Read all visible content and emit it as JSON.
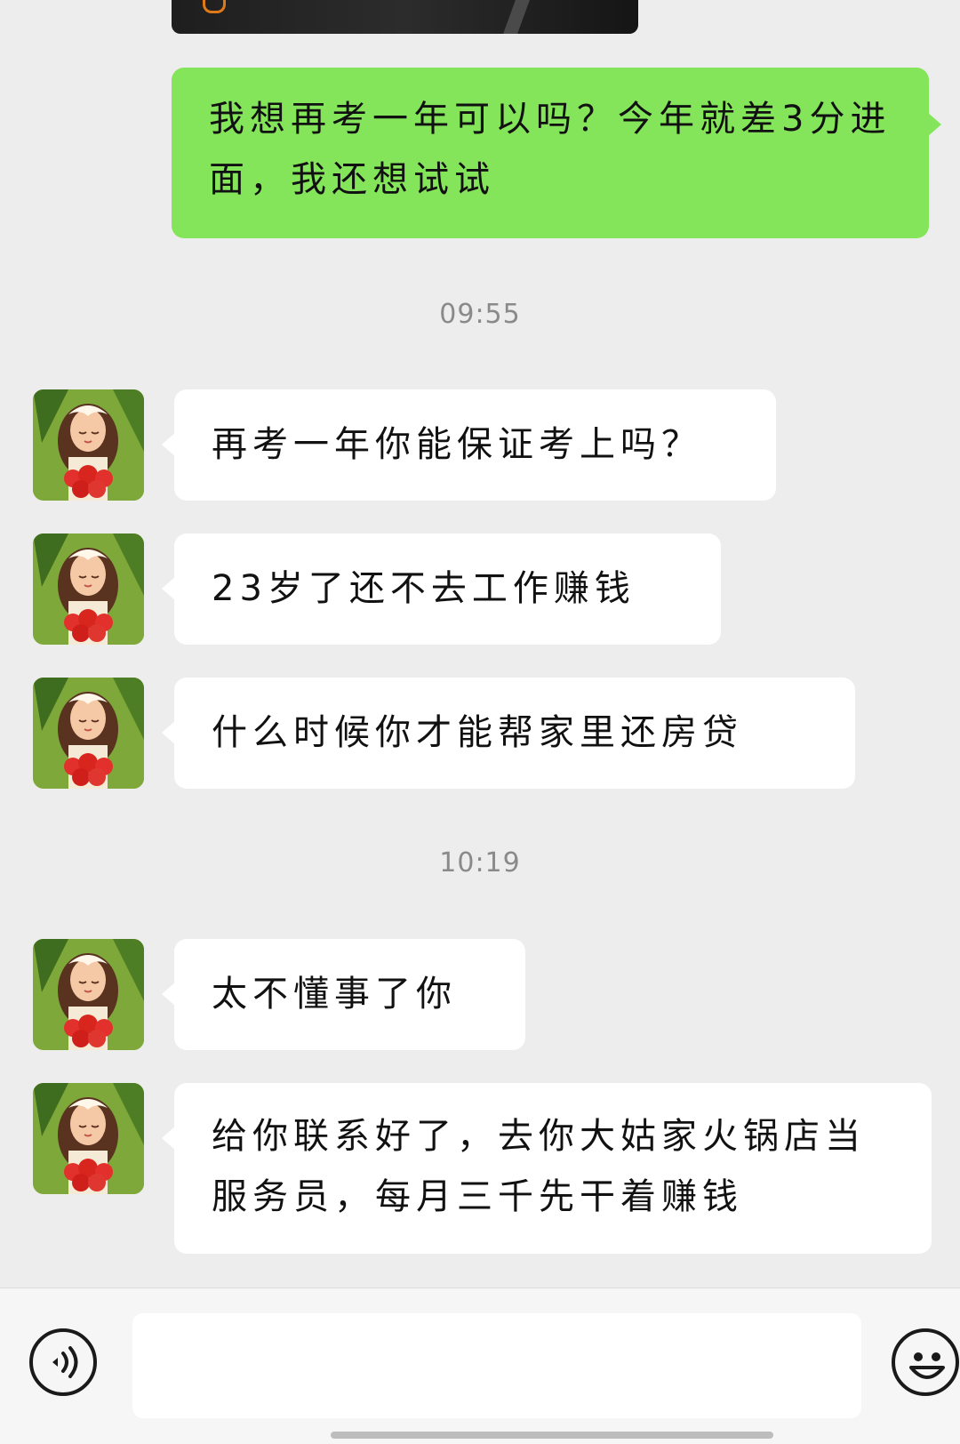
{
  "messages_out": [
    {
      "text": "我想再考一年可以吗？今年就差3分进面，我还想试试"
    }
  ],
  "timestamps": [
    "09:55",
    "10:19"
  ],
  "messages_in": [
    {
      "text": "再考一年你能保证考上吗？"
    },
    {
      "text": "23岁了还不去工作赚钱"
    },
    {
      "text": "什么时候你才能帮家里还房贷"
    },
    {
      "text": "太不懂事了你"
    },
    {
      "text": "给你联系好了，去你大姑家火锅店当服务员，每月三千先干着赚钱"
    }
  ],
  "input": {
    "placeholder": ""
  },
  "icons": {
    "voice": "voice-icon",
    "emoji": "emoji-icon",
    "avatar": "avatar-girl-roses"
  },
  "colors": {
    "background": "#ededed",
    "outgoing_bubble": "#84e55b",
    "incoming_bubble": "#ffffff",
    "timestamp": "#8a8a8a"
  }
}
